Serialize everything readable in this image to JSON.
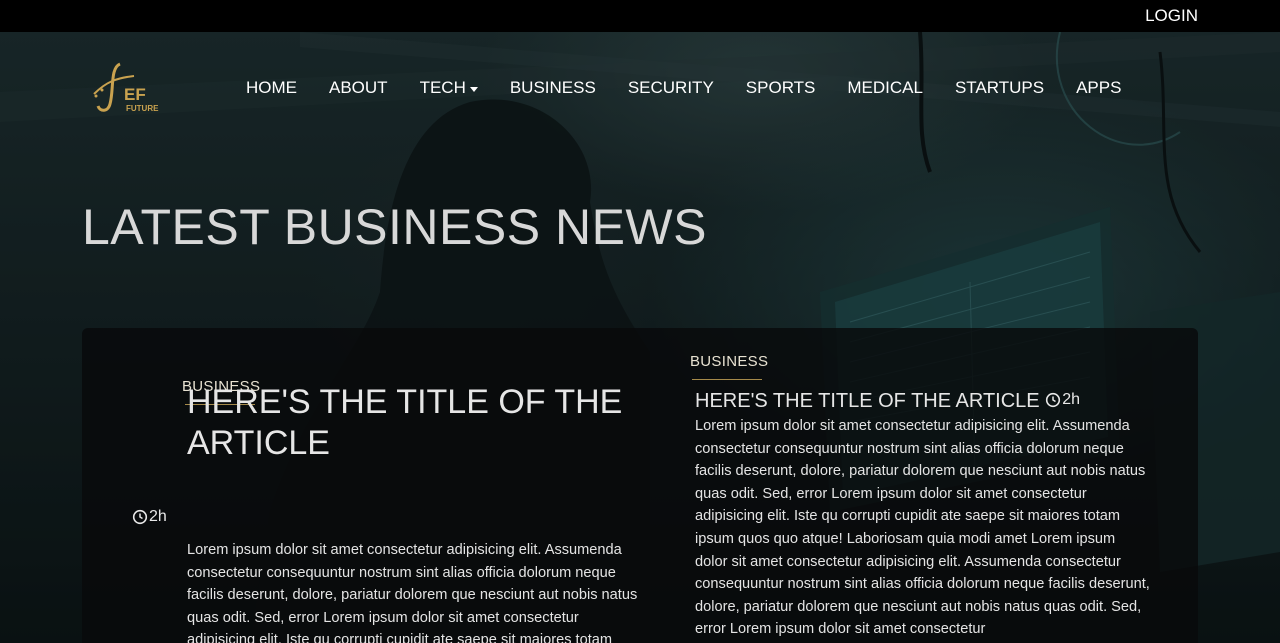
{
  "topbar": {
    "login_label": "LOGIN"
  },
  "brand": {
    "logo_text": "EF",
    "logo_subtext": "FUTURE"
  },
  "nav": {
    "items": [
      {
        "label": "HOME"
      },
      {
        "label": "ABOUT"
      },
      {
        "label": "TECH",
        "has_dropdown": true
      },
      {
        "label": "BUSINESS"
      },
      {
        "label": "SECURITY"
      },
      {
        "label": "SPORTS"
      },
      {
        "label": "MEDICAL"
      },
      {
        "label": "STARTUPS"
      },
      {
        "label": "APPS"
      }
    ]
  },
  "hero": {
    "title": "LATEST BUSINESS NEWS"
  },
  "featured": {
    "category": "BUSINESS",
    "title": "HERE'S THE TITLE OF THE ARTICLE",
    "time": "2h",
    "body": "Lorem ipsum dolor sit amet consectetur adipisicing elit. Assumenda consectetur consequuntur nostrum sint alias officia dolorum neque facilis deserunt, dolore, pariatur dolorem que nesciunt aut nobis natus quas odit. Sed, error Lorem ipsum dolor sit amet consectetur adipisicing elit. Iste qu corrupti cupidit ate saepe sit maiores totam"
  },
  "secondary": {
    "category": "BUSINESS",
    "title": "HERE'S THE TITLE OF THE ARTICLE",
    "time": "2h",
    "body": "Lorem ipsum dolor sit amet consectetur adipisicing elit. Assumenda consectetur consequuntur nostrum sint alias officia dolorum neque facilis deserunt, dolore, pariatur dolorem que nesciunt aut nobis natus quas odit. Sed, error Lorem ipsum dolor sit amet consectetur adipisicing elit. Iste qu corrupti cupidit ate saepe sit maiores totam ipsum quos quo atque! Laboriosam quia modi amet Lorem ipsum dolor sit amet consectetur adipisicing elit. Assumenda consectetur consequuntur nostrum sint alias officia dolorum neque facilis deserunt, dolore, pariatur dolorem que nesciunt aut nobis natus quas odit. Sed, error Lorem ipsum dolor sit amet consectetur"
  },
  "colors": {
    "accent_gold": "#c9a24f",
    "topbar_bg": "#000000",
    "panel_bg": "#080a0b"
  },
  "icons": {
    "clock": "clock-icon",
    "caret": "caret-down-icon"
  }
}
